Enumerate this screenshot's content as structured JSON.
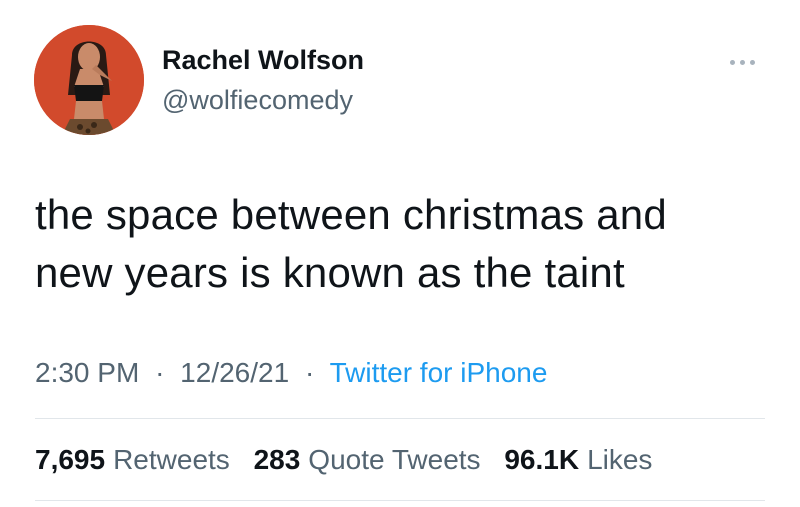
{
  "author": {
    "display_name": "Rachel Wolfson",
    "handle": "@wolfiecomedy"
  },
  "tweet": {
    "lines": [
      "the space between christmas and",
      "new years is known as the taint"
    ]
  },
  "meta": {
    "time": "2:30 PM",
    "date": "12/26/21",
    "source": "Twitter for iPhone",
    "separator": "·"
  },
  "stats": {
    "retweets_count": "7,695",
    "retweets_label": "Retweets",
    "quotes_count": "283",
    "quotes_label": "Quote Tweets",
    "likes_count": "96.1K",
    "likes_label": "Likes"
  },
  "icons": {
    "more": "more-horizontal-icon"
  },
  "colors": {
    "avatar_background": "#d24a2c",
    "link": "#1d9bf0",
    "secondary_text": "#536471",
    "primary_text": "#0f1419"
  }
}
